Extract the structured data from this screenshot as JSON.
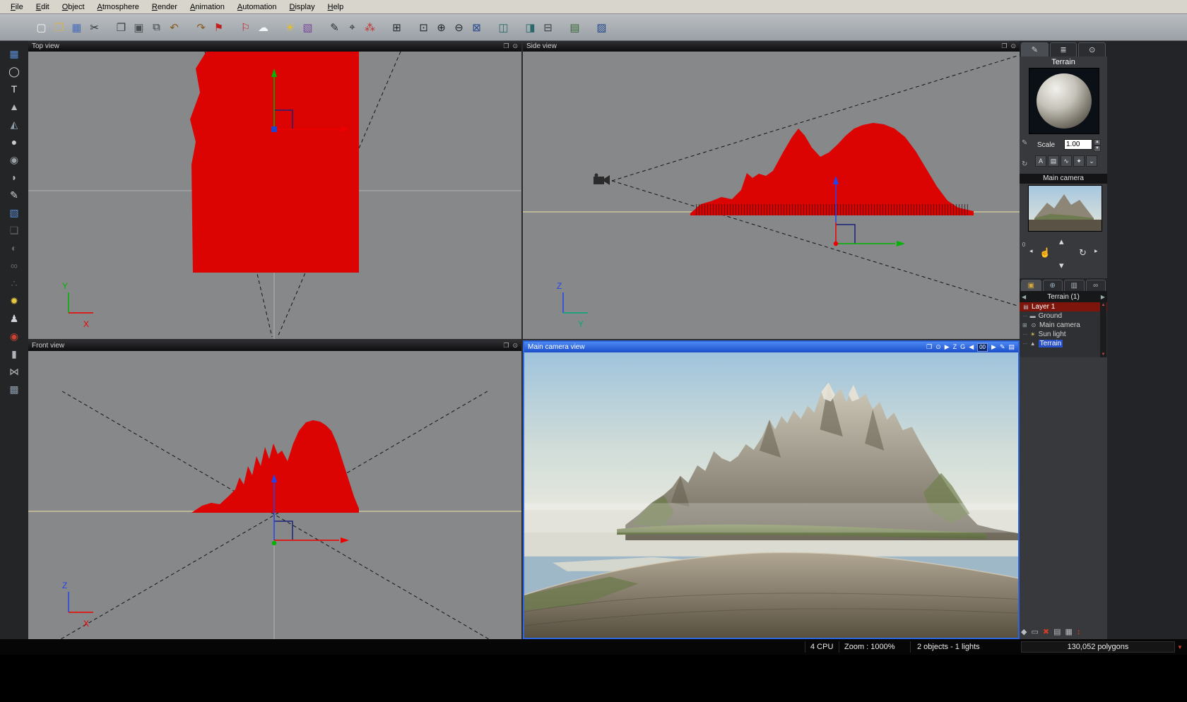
{
  "menu": {
    "items": [
      {
        "name": "menu-file",
        "label": "File"
      },
      {
        "name": "menu-edit",
        "label": "Edit"
      },
      {
        "name": "menu-object",
        "label": "Object"
      },
      {
        "name": "menu-atmosphere",
        "label": "Atmosphere"
      },
      {
        "name": "menu-render",
        "label": "Render"
      },
      {
        "name": "menu-animation",
        "label": "Animation"
      },
      {
        "name": "menu-automation",
        "label": "Automation"
      },
      {
        "name": "menu-display",
        "label": "Display"
      },
      {
        "name": "menu-help",
        "label": "Help"
      }
    ]
  },
  "toolbar": {
    "buttons": [
      {
        "name": "new-scene-button",
        "glyph": "▢",
        "color": "#f2f2f2"
      },
      {
        "name": "open-button",
        "glyph": "❒",
        "color": "#d8b050"
      },
      {
        "name": "save-button",
        "glyph": "▦",
        "color": "#4a6eb8"
      },
      {
        "name": "cut-button",
        "glyph": "✂",
        "color": "#2a2e32"
      },
      {
        "name": "copy-button",
        "glyph": "❐",
        "color": "#3a3e42"
      },
      {
        "name": "paste-button",
        "glyph": "▣",
        "color": "#4a4e52"
      },
      {
        "name": "duplicate-button",
        "glyph": "⧉",
        "color": "#3a3e42"
      },
      {
        "name": "undo-button",
        "glyph": "↶",
        "color": "#8a5a20"
      },
      {
        "name": "redo-button",
        "glyph": "↷",
        "color": "#8a5a20"
      },
      {
        "name": "drop-object-button",
        "glyph": "⚑",
        "color": "#c02020"
      },
      {
        "name": "pick-object-button",
        "glyph": "⚐",
        "color": "#c02020"
      },
      {
        "name": "atmosphere-clouds-button",
        "glyph": "☁",
        "color": "#f2f6fa"
      },
      {
        "name": "atmosphere-sun-button",
        "glyph": "☀",
        "color": "#e8c020"
      },
      {
        "name": "edit-object-button",
        "glyph": "▧",
        "color": "#7a4a9a"
      },
      {
        "name": "paint-material-button",
        "glyph": "✎",
        "color": "#2a2e32"
      },
      {
        "name": "search-object-button",
        "glyph": "⌖",
        "color": "#2a2e32"
      },
      {
        "name": "materials-button",
        "glyph": "⁂",
        "color": "#c03030"
      },
      {
        "name": "zoom-document-button",
        "glyph": "⊞",
        "color": "#24282c"
      },
      {
        "name": "zoom-selection-button",
        "glyph": "⊡",
        "color": "#24282c"
      },
      {
        "name": "zoom-in-button",
        "glyph": "⊕",
        "color": "#24282c"
      },
      {
        "name": "zoom-out-button",
        "glyph": "⊖",
        "color": "#24282c"
      },
      {
        "name": "fit-view-button",
        "glyph": "⊠",
        "color": "#24488a"
      },
      {
        "name": "layout-panels-button",
        "glyph": "◫",
        "color": "#2a6a6a"
      },
      {
        "name": "layout-panels-2-button",
        "glyph": "◨",
        "color": "#2a6a6a"
      },
      {
        "name": "animation-setup-button",
        "glyph": "⊟",
        "color": "#3a3e42"
      },
      {
        "name": "render-options-button",
        "glyph": "▤",
        "color": "#3a6a3a"
      },
      {
        "name": "render-button",
        "glyph": "▨",
        "color": "#24488a"
      }
    ]
  },
  "tools": {
    "items": [
      {
        "name": "tool-selection-grid",
        "glyph": "▦",
        "color": "#5a8ad2"
      },
      {
        "name": "tool-circle",
        "glyph": "◯",
        "color": "#d8dade"
      },
      {
        "name": "tool-text",
        "glyph": "T",
        "color": "#e8e8ea"
      },
      {
        "name": "tool-terrain",
        "glyph": "▲",
        "color": "#b8bcc0"
      },
      {
        "name": "tool-procedural-terrain",
        "glyph": "◭",
        "color": "#8a9aa8"
      },
      {
        "name": "tool-sphere",
        "glyph": "●",
        "color": "#c8ccd0"
      },
      {
        "name": "tool-rock",
        "glyph": "◉",
        "color": "#9aa0a6"
      },
      {
        "name": "tool-dome",
        "glyph": "◗",
        "color": "#b0b4b8"
      },
      {
        "name": "tool-pen",
        "glyph": "✎",
        "color": "#d0d4d8"
      },
      {
        "name": "tool-cube",
        "glyph": "▧",
        "color": "#5a8ad2"
      },
      {
        "name": "tool-group",
        "glyph": "❑",
        "color": "#63676b"
      },
      {
        "name": "tool-boolean",
        "glyph": "◐",
        "color": "#63676b"
      },
      {
        "name": "tool-metaballs",
        "glyph": "∞",
        "color": "#63676b"
      },
      {
        "name": "tool-particles",
        "glyph": "∴",
        "color": "#63676b"
      },
      {
        "name": "tool-light",
        "glyph": "✹",
        "color": "#e8c840"
      },
      {
        "name": "tool-walkthrough",
        "glyph": "♟",
        "color": "#d0d4d8"
      },
      {
        "name": "tool-planet",
        "glyph": "◉",
        "color": "#d04030"
      },
      {
        "name": "tool-column",
        "glyph": "▮",
        "color": "#b0b4b8"
      },
      {
        "name": "tool-mirror",
        "glyph": "⋈",
        "color": "#b0b4b8"
      },
      {
        "name": "tool-magic-cube",
        "glyph": "▩",
        "color": "#8a9aa8"
      }
    ]
  },
  "viewport_icons": {
    "maximize": "❐",
    "render": "⊙"
  },
  "viewports": {
    "top": {
      "title": "Top view",
      "axis_vertical": "Y",
      "axis_horizontal": "X"
    },
    "side": {
      "title": "Side view",
      "axis_vertical": "Z",
      "axis_horizontal": "Y"
    },
    "front": {
      "title": "Front view",
      "axis_vertical": "Z",
      "axis_horizontal": "X"
    },
    "camera": {
      "title": "Main camera view",
      "frame_counter": "00",
      "icons": [
        "❐",
        "⊙",
        "▶",
        "Z",
        "G",
        "◀",
        "▶",
        "✎",
        "▤"
      ]
    }
  },
  "right_panel": {
    "tabs": [
      {
        "name": "tab-aspect",
        "glyph": "✎"
      },
      {
        "name": "tab-numerics",
        "glyph": "≣"
      },
      {
        "name": "tab-animation",
        "glyph": "⊙"
      }
    ],
    "object_name": "Terrain",
    "paint_icon": "✎",
    "refresh_icon": "↻",
    "scale_label": "Scale",
    "scale_value": "1.00",
    "side_buttons": [
      {
        "name": "edit-material-button",
        "glyph": "A"
      },
      {
        "name": "material-list-button",
        "glyph": "▤"
      },
      {
        "name": "smooth-button",
        "glyph": "∿"
      },
      {
        "name": "effects-button",
        "glyph": "✦"
      },
      {
        "name": "more-button",
        "glyph": "⌄"
      }
    ],
    "camera_header": "Main camera",
    "counter_value": "0",
    "nav": {
      "up": "▴",
      "down": "▾",
      "hand": "☝",
      "orbit": "↻",
      "left": "◂",
      "right": "▸"
    },
    "browser_tabs": [
      {
        "name": "browser-tab-objects",
        "glyph": "▣",
        "color": "#d8a838"
      },
      {
        "name": "browser-tab-world",
        "glyph": "⊕",
        "color": "#9ab4c8"
      },
      {
        "name": "browser-tab-library",
        "glyph": "▥",
        "color": "#aab4bc"
      },
      {
        "name": "browser-tab-links",
        "glyph": "∞",
        "color": "#aab4bc"
      }
    ],
    "layers_header": "Terrain (1)",
    "layers": [
      {
        "label": "Layer 1",
        "icon": "▤"
      },
      {
        "label": "Ground",
        "icon": "▬"
      },
      {
        "label": "Main camera",
        "icon": "⊙",
        "expander": "⊞"
      },
      {
        "label": "Sun light",
        "icon": "☀"
      },
      {
        "label": "Terrain",
        "icon": "▲"
      }
    ],
    "bottom_icons": [
      {
        "name": "new-layer-icon",
        "glyph": "◆",
        "color": "#b8bcc0"
      },
      {
        "name": "trash-icon",
        "glyph": "▭",
        "color": "#b8bcc0"
      },
      {
        "name": "delete-icon",
        "glyph": "✖",
        "color": "#d23c28"
      },
      {
        "name": "lock-icon",
        "glyph": "▤",
        "color": "#b8bcc0"
      },
      {
        "name": "display-options-icon",
        "glyph": "▦",
        "color": "#b8bcc0"
      },
      {
        "name": "resize-icon",
        "glyph": "↕",
        "color": "#d23c28"
      }
    ]
  },
  "status_bar": {
    "cpu": "4 CPU",
    "zoom": "Zoom : 1000%",
    "objects": "2 objects - 1 lights",
    "polygons": "130,052 polygons"
  }
}
